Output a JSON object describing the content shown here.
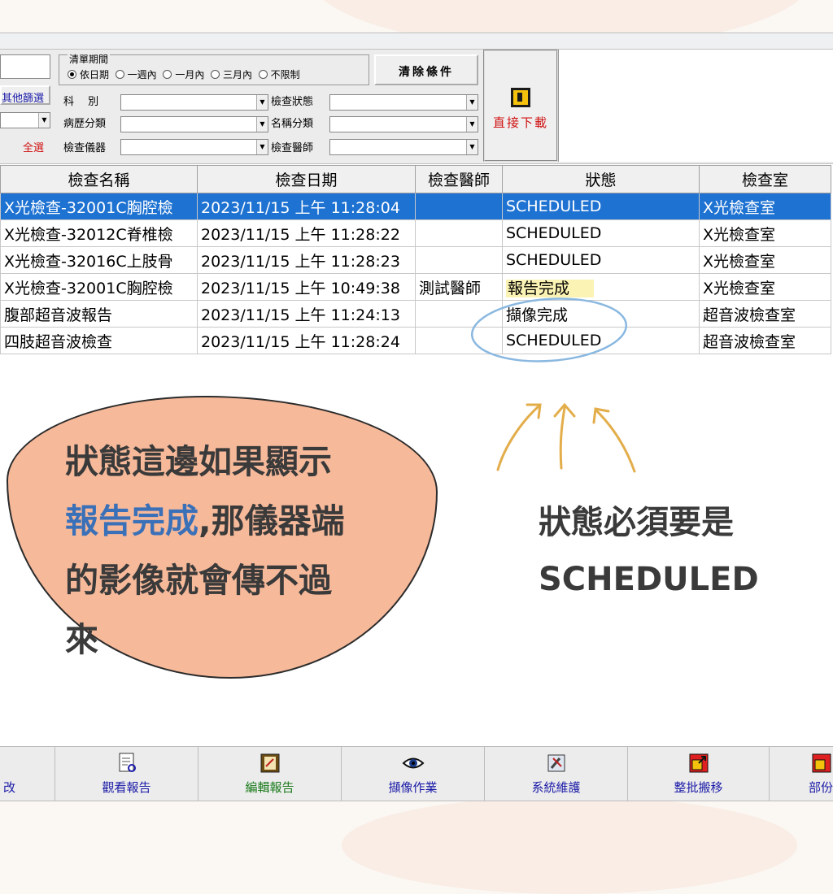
{
  "filters": {
    "other_filter_button": "其他篩選",
    "select_all_link": "全選",
    "period_group_title": "清單期間",
    "period_options": [
      "依日期",
      "一週內",
      "一月內",
      "三月內",
      "不限制"
    ],
    "period_selected": "依日期",
    "clear_button": "清除條件",
    "dept_label": "科　 別",
    "record_type_label": "病歷分類",
    "device_label": "檢查儀器",
    "exam_status_label": "檢查狀態",
    "name_type_label": "名稱分類",
    "physician_label": "檢查醫師",
    "direct_download_label": "直接下載"
  },
  "table": {
    "headers": [
      "檢查名稱",
      "檢查日期",
      "檢查醫師",
      "狀態",
      "檢查室"
    ],
    "rows": [
      {
        "name": "X光檢查-32001C胸腔檢",
        "date": "2023/11/15 上午 11:28:04",
        "doctor": "",
        "status": "SCHEDULED",
        "room": "X光檢查室"
      },
      {
        "name": "X光檢查-32012C脊椎檢",
        "date": "2023/11/15 上午 11:28:22",
        "doctor": "",
        "status": "SCHEDULED",
        "room": "X光檢查室"
      },
      {
        "name": "X光檢查-32016C上肢骨",
        "date": "2023/11/15 上午 11:28:23",
        "doctor": "",
        "status": "SCHEDULED",
        "room": "X光檢查室"
      },
      {
        "name": "X光檢查-32001C胸腔檢",
        "date": "2023/11/15 上午 10:49:38",
        "doctor": "測試醫師",
        "status": "報告完成",
        "room": "X光檢查室"
      },
      {
        "name": "腹部超音波報告",
        "date": "2023/11/15 上午 11:24:13",
        "doctor": "",
        "status": "擷像完成",
        "room": "超音波檢查室"
      },
      {
        "name": "四肢超音波檢查",
        "date": "2023/11/15 上午 11:28:24",
        "doctor": "",
        "status": "SCHEDULED",
        "room": "超音波檢查室"
      }
    ]
  },
  "annotations": {
    "left_line1": "狀態這邊如果顯示",
    "left_highlight": "報告完成",
    "left_line2_rest": ",那儀器端",
    "left_line3": "的影像就會傳不過",
    "left_line4": "來",
    "right_line1": "狀態必須要是",
    "right_line2": "SCHEDULED"
  },
  "toolbar": {
    "buttons": [
      "改",
      "觀看報告",
      "編輯報告",
      "擷像作業",
      "系統維護",
      "整批搬移",
      "部份"
    ]
  },
  "colors": {
    "selected_row": "#1e72d2",
    "blob_fill": "#f6b99a",
    "highlight_blue": "#3a70b8",
    "arrow_color": "#e3ad4a",
    "circle_color": "#8ab8e0",
    "button_text": "#1a1aa8"
  }
}
